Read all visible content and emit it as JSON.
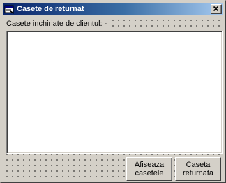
{
  "window": {
    "title": "Casete de returnat",
    "title_icon": "app-window-icon",
    "close_icon": "close-icon"
  },
  "label": {
    "text": "Casete inchiriate de clientul: -"
  },
  "list": {
    "items": []
  },
  "buttons": {
    "show_line1": "Afiseaza",
    "show_line2": "casetele",
    "return_line1": "Caseta",
    "return_line2": "returnata"
  },
  "colors": {
    "title_active": "#0a246a",
    "title_gradient_end": "#a6caf0",
    "face": "#d4d0c8",
    "list_background": "#ffffff"
  }
}
